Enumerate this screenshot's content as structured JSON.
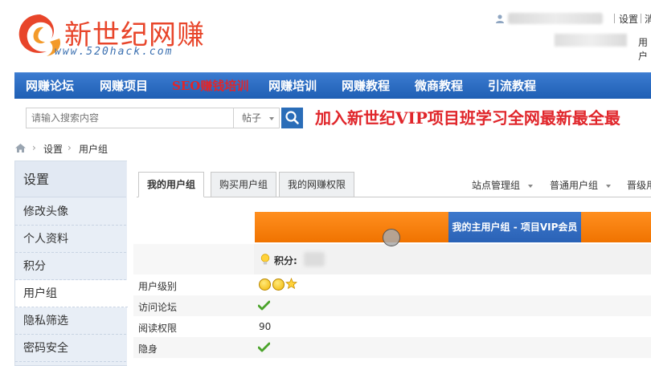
{
  "header": {
    "logo_title": "新世纪网赚",
    "logo_url": "www.520hack.com",
    "user_links": [
      "设置",
      "消"
    ],
    "user_link2": "用户"
  },
  "nav": {
    "items": [
      "网赚论坛",
      "网赚项目",
      "SEO赚钱培训",
      "网赚培训",
      "网赚教程",
      "微商教程",
      "引流教程"
    ]
  },
  "search": {
    "placeholder": "请输入搜索内容",
    "type": "帖子",
    "promo": "加入新世纪VIP项目班学习全网最新最全最"
  },
  "breadcrumb": [
    "设置",
    "用户组"
  ],
  "sidebar": {
    "title": "设置",
    "items": [
      "修改头像",
      "个人资料",
      "积分",
      "用户组",
      "隐私筛选",
      "密码安全"
    ],
    "active": "用户组"
  },
  "tabs": {
    "items": [
      "我的用户组",
      "购买用户组",
      "我的网赚权限"
    ],
    "active": "我的用户组",
    "right": [
      "站点管理组",
      "普通用户组",
      "晋级用"
    ]
  },
  "content": {
    "group_header": "我的主用户组 - 项目VIP会员",
    "points_label": "积分:",
    "rows": [
      {
        "label": "用户级别",
        "value": ""
      },
      {
        "label": "访问论坛",
        "value": ""
      },
      {
        "label": "阅读权限",
        "value": "90"
      },
      {
        "label": "隐身",
        "value": ""
      }
    ]
  },
  "colors": {
    "nav_blue": "#1f5fb4",
    "accent_red": "#e0262b",
    "orange": "#f07300",
    "check_green": "#4aa32a"
  }
}
